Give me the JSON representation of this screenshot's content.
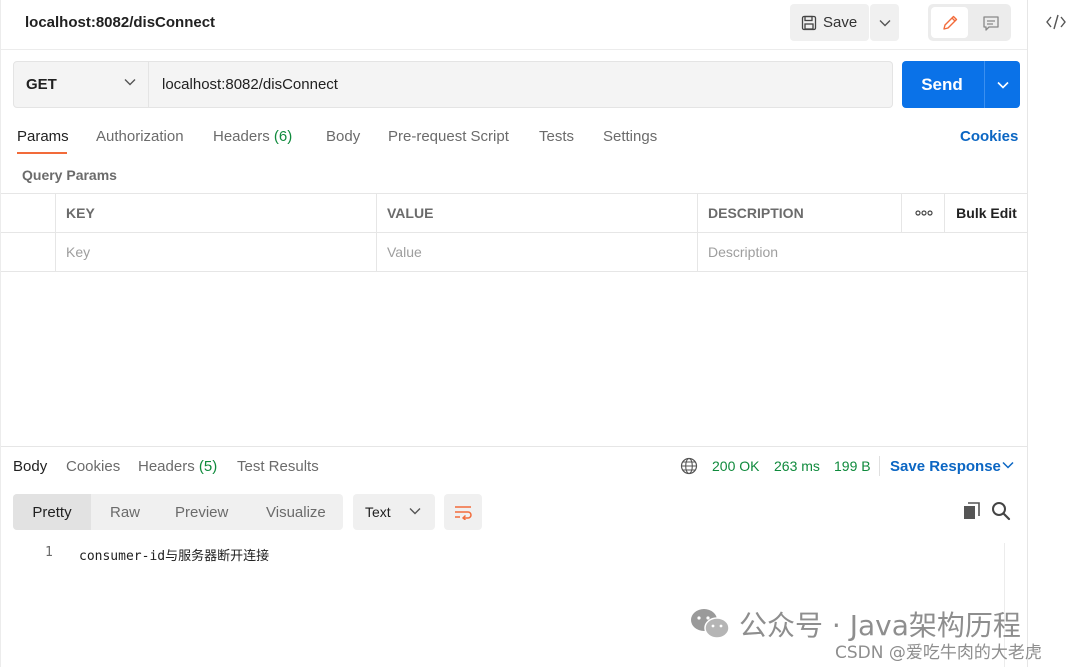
{
  "request": {
    "title": "localhost:8082/disConnect",
    "save_label": "Save",
    "method": "GET",
    "url": "localhost:8082/disConnect",
    "send_label": "Send"
  },
  "request_tabs": {
    "params": "Params",
    "authorization": "Authorization",
    "headers": "Headers",
    "headers_count": "(6)",
    "body": "Body",
    "pre_request_script": "Pre-request Script",
    "tests": "Tests",
    "settings": "Settings",
    "cookies": "Cookies"
  },
  "query_params": {
    "label": "Query Params",
    "columns": {
      "key": "KEY",
      "value": "VALUE",
      "description": "DESCRIPTION",
      "bulk_edit": "Bulk Edit"
    },
    "placeholders": {
      "key": "Key",
      "value": "Value",
      "description": "Description"
    }
  },
  "response": {
    "tabs": {
      "body": "Body",
      "cookies": "Cookies",
      "headers": "Headers",
      "headers_count": "(5)",
      "test_results": "Test Results"
    },
    "status": "200 OK",
    "time": "263 ms",
    "size": "199 B",
    "save_response": "Save Response",
    "formats": {
      "pretty": "Pretty",
      "raw": "Raw",
      "preview": "Preview",
      "visualize": "Visualize"
    },
    "content_type": "Text",
    "lines": [
      {
        "number": "1",
        "text": "consumer-id与服务器断开连接"
      }
    ]
  },
  "watermark": {
    "line1": "公众号 · Java架构历程",
    "line2": "CSDN @爱吃牛肉的大老虎"
  },
  "colors": {
    "accent": "#0a72e8",
    "tab_underline": "#f26b3a",
    "status_green": "#0f8a3c",
    "link_blue": "#0b66c3"
  },
  "icons": [
    "save-icon",
    "chevron-down-icon",
    "edit-pencil-icon",
    "comment-icon",
    "code-icon",
    "more-dots-icon",
    "globe-icon",
    "wrap-lines-icon",
    "copy-icon",
    "search-icon",
    "wechat-icon"
  ]
}
